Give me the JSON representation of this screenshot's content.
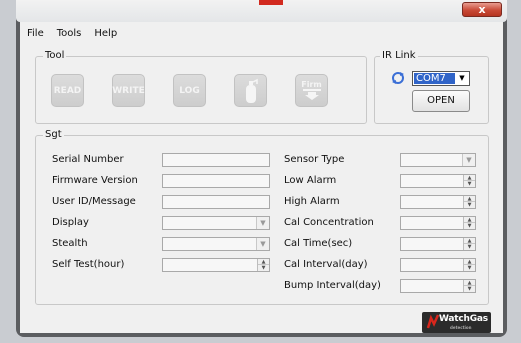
{
  "window": {
    "close_glyph": "x"
  },
  "menu": {
    "items": [
      "File",
      "Tools",
      "Help"
    ]
  },
  "tool_group": {
    "title": "Tool",
    "buttons": [
      {
        "label": "READ",
        "name": "read-button"
      },
      {
        "label": "WRITE",
        "name": "write-button"
      },
      {
        "label": "LOG",
        "name": "log-button"
      },
      {
        "label": "",
        "icon": "gas-cylinder-icon",
        "name": "cylinder-button"
      },
      {
        "label": "Firm",
        "icon": "download-arrow-icon",
        "name": "firmware-button"
      }
    ]
  },
  "ir_link": {
    "title": "IR Link",
    "port": "COM7",
    "open_label": "OPEN",
    "refresh_icon": "refresh-icon"
  },
  "sgt": {
    "title": "Sgt",
    "left_fields": [
      {
        "label": "Serial Number",
        "type": "text",
        "value": ""
      },
      {
        "label": "Firmware Version",
        "type": "text",
        "value": ""
      },
      {
        "label": "User ID/Message",
        "type": "text",
        "value": ""
      },
      {
        "label": "Display",
        "type": "combo",
        "value": ""
      },
      {
        "label": "Stealth",
        "type": "combo",
        "value": ""
      },
      {
        "label": "Self Test(hour)",
        "type": "spin",
        "value": ""
      }
    ],
    "right_fields": [
      {
        "label": "Sensor Type",
        "type": "combo",
        "value": ""
      },
      {
        "label": "Low Alarm",
        "type": "spin",
        "value": ""
      },
      {
        "label": "High Alarm",
        "type": "spin",
        "value": ""
      },
      {
        "label": "Cal Concentration",
        "type": "spin",
        "value": ""
      },
      {
        "label": "Cal Time(sec)",
        "type": "spin",
        "value": ""
      },
      {
        "label": "Cal Interval(day)",
        "type": "spin",
        "value": ""
      },
      {
        "label": "Bump Interval(day)",
        "type": "spin",
        "value": ""
      }
    ]
  },
  "logo": {
    "text": "WatchGas",
    "sub": "detection"
  },
  "colors": {
    "accent": "#3064c8",
    "close": "#c94a37",
    "logo_red": "#d8261c"
  }
}
